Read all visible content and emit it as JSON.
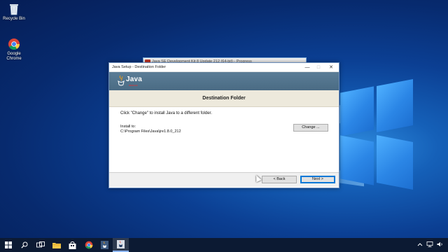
{
  "desktop": {
    "icons": [
      {
        "label": "Recycle Bin",
        "icon": "recycle-bin-icon"
      },
      {
        "label": "Google Chrome",
        "icon": "chrome-icon"
      }
    ]
  },
  "progress_window": {
    "title": "Java SE Development Kit 8 Update 212 (64-bit) - Progress"
  },
  "setup": {
    "title": "Java Setup - Destination Folder",
    "logo_text": "Java",
    "logo_sub": "ORACLE",
    "header": "Destination Folder",
    "instruction": "Click \"Change\" to install Java to a different folder.",
    "install_label": "Install to:",
    "install_path": "C:\\Program Files\\Java\\jre1.8.0_212",
    "change_label": "Change ...",
    "back_label": "< Back",
    "next_label": "Next >",
    "window_buttons": {
      "minimize": "—",
      "maximize": "□",
      "close": "✕"
    }
  },
  "taskbar": {
    "items": [
      "windows-start-icon",
      "search-icon",
      "task-view-icon",
      "file-explorer-icon",
      "store-icon",
      "chrome-icon",
      "java-setup-icon",
      "java-installer-icon"
    ],
    "tray": [
      "chevron-up-icon",
      "network-icon",
      "volume-icon"
    ]
  },
  "colors": {
    "banner": "#4a6b84",
    "header_bar": "#ede9dc",
    "taskbar": "#0c1a33",
    "accent": "#0078d7"
  }
}
